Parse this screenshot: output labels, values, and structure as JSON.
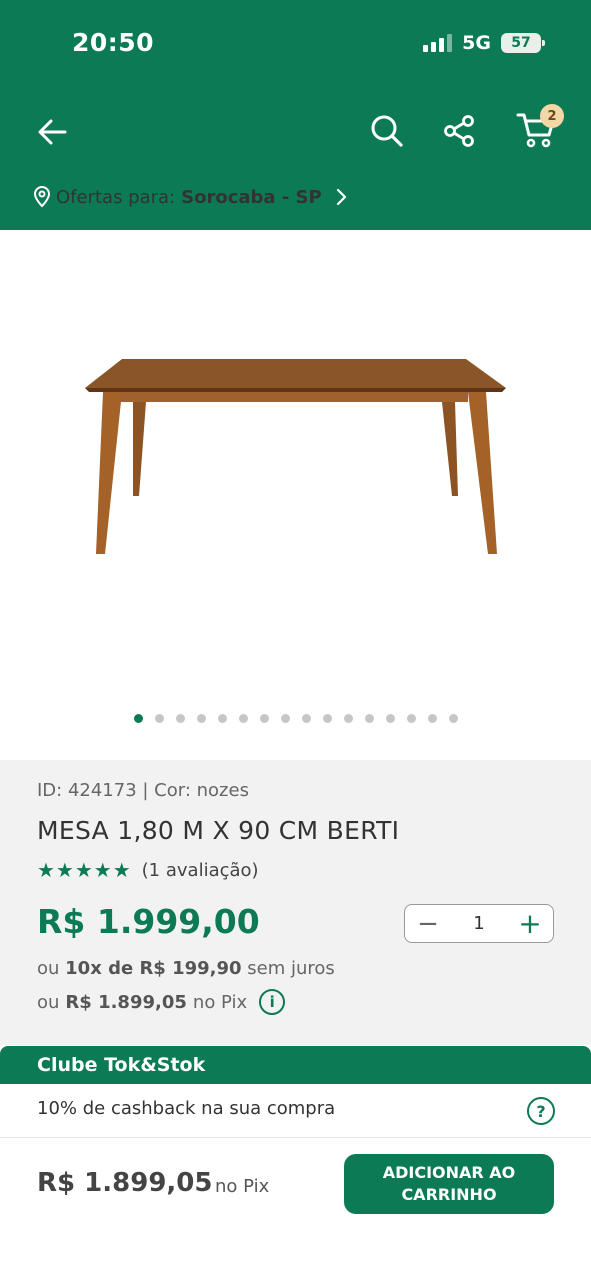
{
  "status_bar": {
    "time": "20:50",
    "network": "5G",
    "battery": "57"
  },
  "header": {
    "cart_count": "2",
    "location_prefix": "Ofertas para:",
    "location_city": "Sorocaba - SP"
  },
  "gallery": {
    "total_images": 16,
    "active_index": 0
  },
  "product": {
    "id_line": "ID: 424173 | Cor: nozes",
    "title": "MESA 1,80 M X 90 CM BERTI",
    "stars": "★★★★★",
    "rating_text": "(1 avaliação)",
    "price": "R$ 1.999,00",
    "quantity": "1",
    "installment_prefix": "ou",
    "installment_value": "10x de R$ 199,90",
    "installment_suffix": "sem juros",
    "pix_prefix": "ou",
    "pix_value": "R$ 1.899,05",
    "pix_suffix": "no Pix"
  },
  "club": {
    "title": "Clube Tok&Stok",
    "text": "10% de cashback na sua compra"
  },
  "bottom": {
    "price": "R$ 1.899,05",
    "price_suffix": "no Pix",
    "add_button": "ADICIONAR AO CARRINHO"
  },
  "colors": {
    "brand": "#0c7a55",
    "panel": "#f2f2f2"
  }
}
